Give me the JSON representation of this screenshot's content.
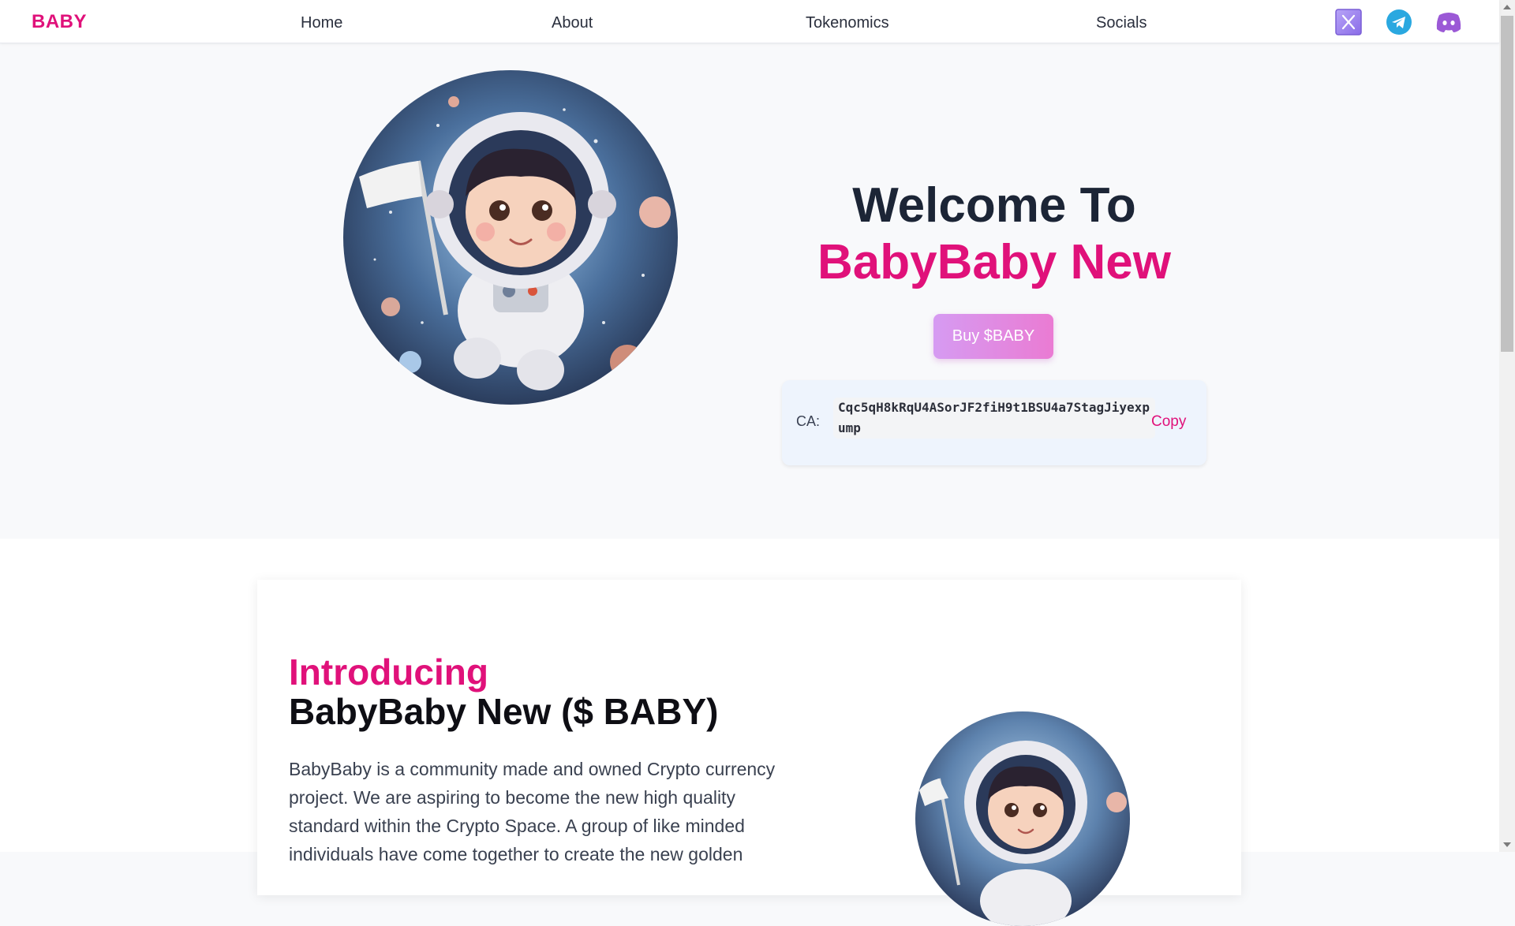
{
  "nav": {
    "logo": "BABY",
    "links": [
      "Home",
      "About",
      "Tokenomics",
      "Socials"
    ],
    "socials": [
      {
        "name": "x-icon",
        "color": "#a78bfa"
      },
      {
        "name": "telegram-icon",
        "color": "#2aa8e0"
      },
      {
        "name": "discord-icon",
        "color": "#9b59d6"
      }
    ]
  },
  "hero": {
    "title_line1": "Welcome To",
    "title_line2": "BabyBaby New",
    "buy_button": "Buy $BABY",
    "ca_label": "CA:",
    "ca_value": "Cqc5qH8kRqU4ASorJF2fiH9t1BSU4a7StagJiyexpump",
    "copy_label": "Copy"
  },
  "about": {
    "heading_line1": "Introducing",
    "heading_line2": "BabyBaby New ($ BABY)",
    "paragraph": "BabyBaby is a community made and owned Crypto currency project. We are aspiring to become the new high quality standard within the Crypto Space. A group of like minded individuals have come together to create the new golden"
  },
  "colors": {
    "accent": "#e0117a",
    "dark_text": "#1c2536",
    "button_gradient_start": "#d69bf2",
    "button_gradient_end": "#ea7bd3"
  }
}
